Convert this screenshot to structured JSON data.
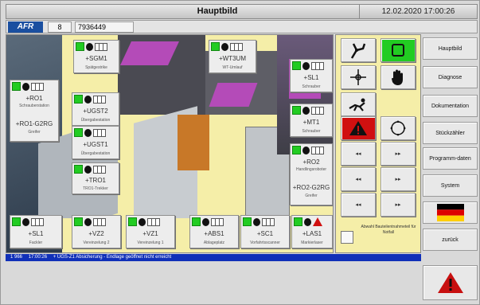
{
  "header": {
    "title": "Hauptbild",
    "datetime": "12.02.2020 17:00:26",
    "logo": "AFR",
    "field1": "8",
    "field2": "7936449"
  },
  "stations": [
    {
      "id": "+SGM1",
      "sub": "Spätgestrike"
    },
    {
      "id": "+WT3UM",
      "sub": "WT-Umlauf"
    },
    {
      "id": "+RO1",
      "sub": "Schrauberstation"
    },
    {
      "id": "+RO1-G2RG",
      "sub": "Greifer"
    },
    {
      "id": "+UGST2",
      "sub": "Übergabestation"
    },
    {
      "id": "+UGST1",
      "sub": "Übergabestation"
    },
    {
      "id": "+TRO1",
      "sub": "TRO1-Trekker"
    },
    {
      "id": "+SL1",
      "sub": "Schrauber"
    },
    {
      "id": "+MT1",
      "sub": "Schrauber"
    },
    {
      "id": "+RO2",
      "sub": "Handlingsroboter"
    },
    {
      "id": "+RO2-G2RG",
      "sub": "Greifer"
    },
    {
      "id": "+SL1",
      "sub": "Fackler"
    },
    {
      "id": "+VZ2",
      "sub": "Vereinzelung 2"
    },
    {
      "id": "+VZ1",
      "sub": "Vereinzelung 1"
    },
    {
      "id": "+ABS1",
      "sub": "Ablageplatz"
    },
    {
      "id": "+SC1",
      "sub": "Vorfahrtsscanner"
    },
    {
      "id": "+LAS1",
      "sub": "Markierlaser"
    }
  ],
  "controls": {
    "btn_left": "◂◂",
    "btn_right": "▸▸",
    "note": "Abwahl Bauteilentnahmeteil für Notfall"
  },
  "menu": {
    "items": [
      "Hauptbild",
      "Diagnose",
      "Dokumentation",
      "Stückzähler",
      "Programm-daten",
      "System",
      "zurück"
    ]
  },
  "status": {
    "code": "1 966",
    "time": "17:00:26",
    "message": "+ UGS-Z1 Absicherung - Endlage geöffnet nicht erreicht"
  },
  "colors": {
    "background": "#f5eea8",
    "status_bar": "#1030b8",
    "alarm_red": "#d01010",
    "ok_green": "#22cc22"
  }
}
